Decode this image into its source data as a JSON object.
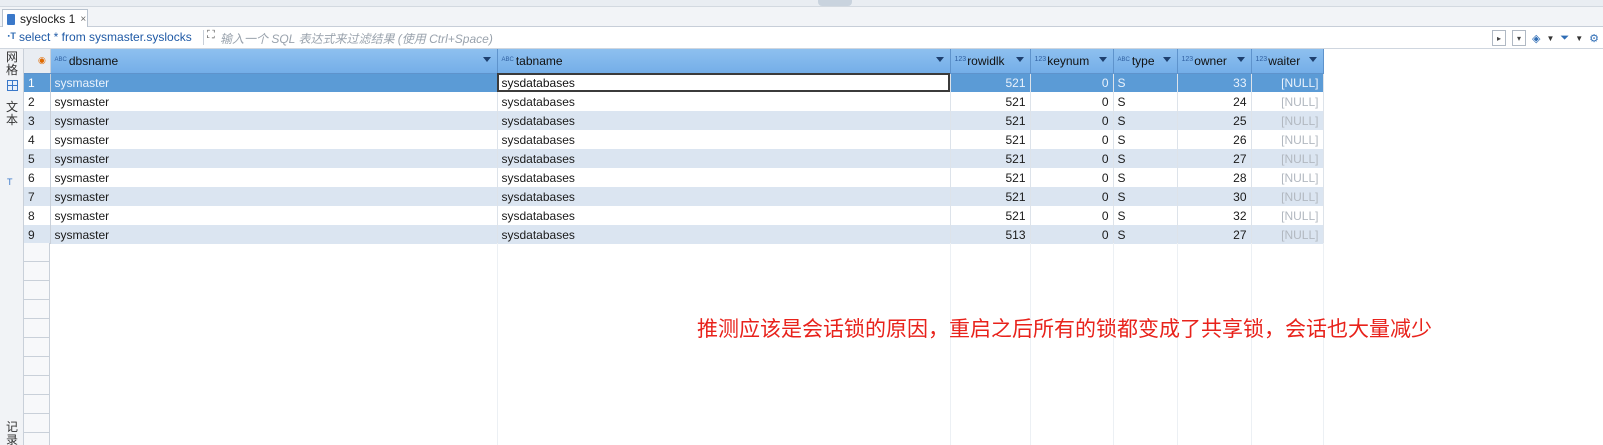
{
  "tab": {
    "title": "syslocks 1",
    "close_glyph": "×"
  },
  "filter_bar": {
    "sql": "select * from sysmaster.syslocks",
    "placeholder": "输入一个 SQL 表达式来过滤结果 (使用 Ctrl+Space)"
  },
  "side_tabs": {
    "grid": "网格",
    "text": "文本",
    "record": "记录"
  },
  "columns": [
    {
      "name": "dbsname",
      "type": "abc"
    },
    {
      "name": "tabname",
      "type": "abc"
    },
    {
      "name": "rowidlk",
      "type": "123"
    },
    {
      "name": "keynum",
      "type": "123"
    },
    {
      "name": "type",
      "type": "abc"
    },
    {
      "name": "owner",
      "type": "123"
    },
    {
      "name": "waiter",
      "type": "123"
    }
  ],
  "rows": [
    {
      "n": "1",
      "dbsname": "sysmaster",
      "tabname": "sysdatabases",
      "rowidlk": "521",
      "keynum": "0",
      "type": "S",
      "owner": "33",
      "waiter": "[NULL]"
    },
    {
      "n": "2",
      "dbsname": "sysmaster",
      "tabname": "sysdatabases",
      "rowidlk": "521",
      "keynum": "0",
      "type": "S",
      "owner": "24",
      "waiter": "[NULL]"
    },
    {
      "n": "3",
      "dbsname": "sysmaster",
      "tabname": "sysdatabases",
      "rowidlk": "521",
      "keynum": "0",
      "type": "S",
      "owner": "25",
      "waiter": "[NULL]"
    },
    {
      "n": "4",
      "dbsname": "sysmaster",
      "tabname": "sysdatabases",
      "rowidlk": "521",
      "keynum": "0",
      "type": "S",
      "owner": "26",
      "waiter": "[NULL]"
    },
    {
      "n": "5",
      "dbsname": "sysmaster",
      "tabname": "sysdatabases",
      "rowidlk": "521",
      "keynum": "0",
      "type": "S",
      "owner": "27",
      "waiter": "[NULL]"
    },
    {
      "n": "6",
      "dbsname": "sysmaster",
      "tabname": "sysdatabases",
      "rowidlk": "521",
      "keynum": "0",
      "type": "S",
      "owner": "28",
      "waiter": "[NULL]"
    },
    {
      "n": "7",
      "dbsname": "sysmaster",
      "tabname": "sysdatabases",
      "rowidlk": "521",
      "keynum": "0",
      "type": "S",
      "owner": "30",
      "waiter": "[NULL]"
    },
    {
      "n": "8",
      "dbsname": "sysmaster",
      "tabname": "sysdatabases",
      "rowidlk": "521",
      "keynum": "0",
      "type": "S",
      "owner": "32",
      "waiter": "[NULL]"
    },
    {
      "n": "9",
      "dbsname": "sysmaster",
      "tabname": "sysdatabases",
      "rowidlk": "513",
      "keynum": "0",
      "type": "S",
      "owner": "27",
      "waiter": "[NULL]"
    }
  ],
  "annotation": "推测应该是会话锁的原因，重启之后所有的锁都变成了共享锁，会话也大量减少",
  "colors": {
    "header": "#74aee8",
    "row_alt": "#dbe5f1",
    "selected": "#5b9bd6",
    "annotation": "#e8221b"
  }
}
